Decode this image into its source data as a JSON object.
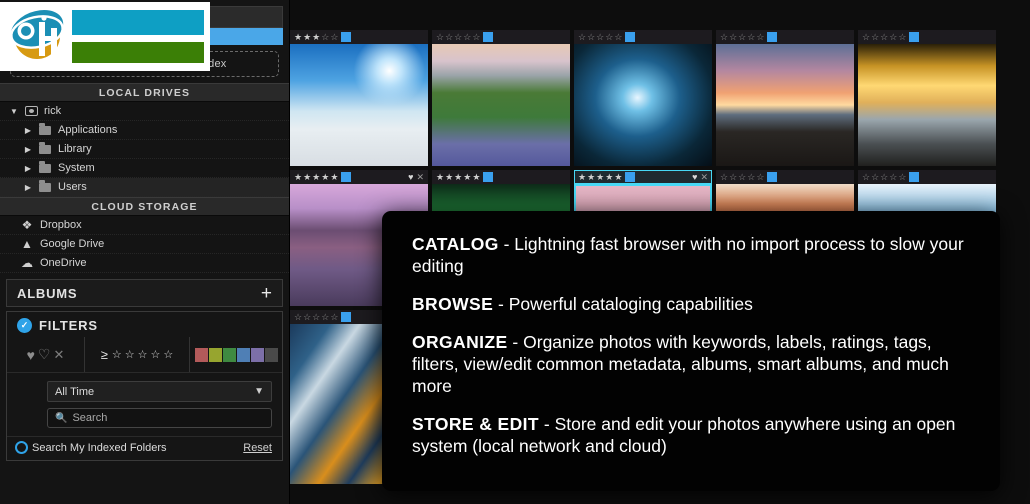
{
  "sidebar": {
    "dropzone": {
      "label": "Drop Your Folders Here to Index"
    },
    "local_drives": {
      "header": "LOCAL DRIVES",
      "items": [
        {
          "label": "rick",
          "icon": "drive-icon",
          "twisty": "expanded",
          "indent": 0
        },
        {
          "label": "Applications",
          "icon": "folder-icon",
          "twisty": "collapsed",
          "indent": 1
        },
        {
          "label": "Library",
          "icon": "folder-icon",
          "twisty": "collapsed",
          "indent": 1
        },
        {
          "label": "System",
          "icon": "folder-icon",
          "twisty": "collapsed",
          "indent": 1
        },
        {
          "label": "Users",
          "icon": "folder-icon",
          "twisty": "collapsed",
          "indent": 1,
          "selected": true
        }
      ]
    },
    "cloud_storage": {
      "header": "CLOUD STORAGE",
      "items": [
        {
          "label": "Dropbox",
          "icon": "dropbox-icon"
        },
        {
          "label": "Google Drive",
          "icon": "google-drive-icon"
        },
        {
          "label": "OneDrive",
          "icon": "onedrive-icon"
        }
      ]
    },
    "albums": {
      "title": "ALBUMS",
      "add_icon": "plus-icon"
    },
    "filters": {
      "title": "FILTERS",
      "enabled_icon": "check-circle-icon",
      "flag_icons": [
        "heart-filled-icon",
        "heart-outline-icon",
        "x-icon"
      ],
      "rating_operator": "≥",
      "rating_stars": 5,
      "rating_value": 0,
      "color_labels": [
        "#b35a5a",
        "#97a52f",
        "#3f8a41",
        "#4f7fb5",
        "#7c6fa8",
        "#4a4a4a"
      ],
      "time_select": {
        "value": "All Time",
        "chevron_icon": "chevron-down-icon"
      },
      "search": {
        "placeholder": "Search",
        "value": "",
        "icon": "search-icon"
      },
      "indexed_folders": {
        "label": "Search My Indexed Folders",
        "radio_icon": "radio-icon"
      },
      "reset": "Reset"
    }
  },
  "grid": {
    "rows": [
      {
        "height": "h2",
        "cells": [
          {
            "name": "mountain-camp-sunburst",
            "rating": 3,
            "max_rating": 5,
            "color_label": "#3aa0ee",
            "flags": [],
            "selected": false
          },
          {
            "name": "church-in-lupine-field",
            "rating": 0,
            "max_rating": 5,
            "color_label": "#3aa0ee",
            "flags": [],
            "selected": false
          },
          {
            "name": "blue-ice-cave",
            "rating": 0,
            "max_rating": 5,
            "color_label": "#3aa0ee",
            "flags": [],
            "selected": false
          },
          {
            "name": "pink-sunset-beach-ice",
            "rating": 0,
            "max_rating": 5,
            "color_label": "#3aa0ee",
            "flags": [],
            "selected": false
          },
          {
            "name": "golden-sunset-diamond-beach",
            "rating": 0,
            "max_rating": 5,
            "color_label": "#3aa0ee",
            "flags": [],
            "selected": false
          }
        ]
      },
      {
        "height": "h2",
        "cells": [
          {
            "name": "purple-mountain-reflection",
            "rating": 5,
            "max_rating": 5,
            "color_label": "#3aa0ee",
            "flags": [
              "heart-filled-icon",
              "x-icon"
            ],
            "selected": false
          },
          {
            "name": "green-aurora",
            "rating": 5,
            "max_rating": 5,
            "color_label": "#3aa0ee",
            "flags": [],
            "selected": false
          },
          {
            "name": "pink-starry-sky",
            "rating": 5,
            "max_rating": 5,
            "color_label": "#3aa0ee",
            "flags": [
              "heart-filled-icon",
              "x-icon"
            ],
            "selected": true
          },
          {
            "name": "red-canyon-dusk",
            "rating": 0,
            "max_rating": 5,
            "color_label": "#3aa0ee",
            "flags": [],
            "selected": false
          },
          {
            "name": "blue-glacier-crevasse",
            "rating": 0,
            "max_rating": 5,
            "color_label": "#3aa0ee",
            "flags": [],
            "selected": false
          }
        ]
      },
      {
        "height": "h3",
        "cells": [
          {
            "name": "blue-orange-aerial-river",
            "rating": 0,
            "max_rating": 5,
            "color_label": "#3aa0ee",
            "flags": [],
            "selected": false
          }
        ]
      }
    ]
  },
  "feature_panel": {
    "items": [
      {
        "key": "CATALOG",
        "dash": "-",
        "text": "Lightning fast browser with no import process to slow your editing"
      },
      {
        "key": "BROWSE",
        "dash": "-",
        "text": "Powerful cataloging capabilities"
      },
      {
        "key": "ORGANIZE",
        "dash": "-",
        "text": "Organize photos with keywords, labels, ratings, tags, filters, view/edit common metadata, albums, smart albums, and much more"
      },
      {
        "key": "STORE & EDIT",
        "dash": "-",
        "text": "Store and edit your photos anywhere using an open system (local network and cloud)"
      }
    ]
  },
  "watermark": {
    "name": "site-logo-watermark",
    "colors": {
      "circle_blue": "#1b8fb5",
      "circle_gold": "#d79a12",
      "bar_top": "#0e9fc4",
      "bar_bottom": "#3b7f06"
    }
  }
}
